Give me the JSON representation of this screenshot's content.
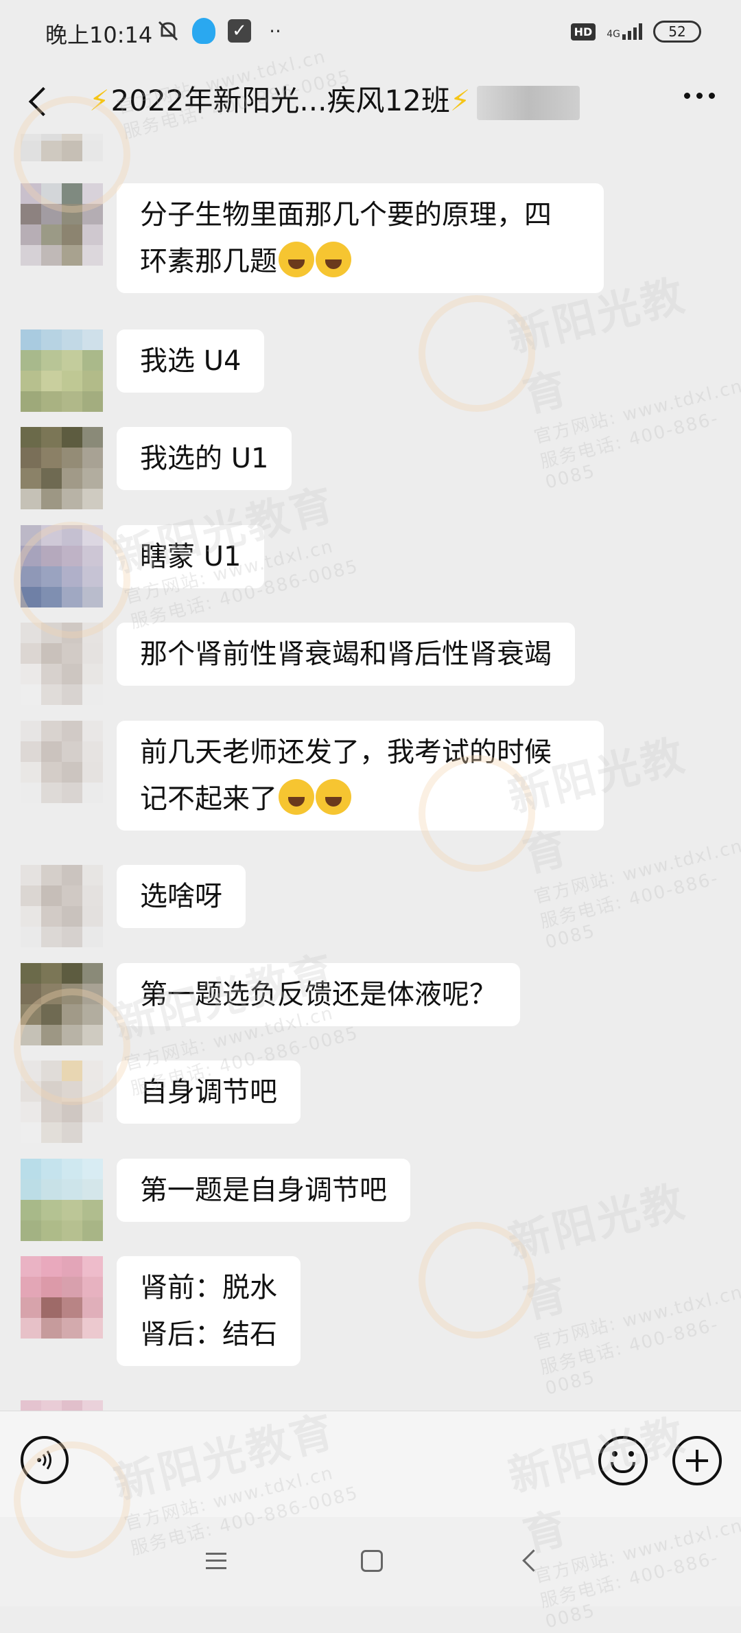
{
  "status_bar": {
    "time": "晚上10:14",
    "network": "4G",
    "hd": "HD",
    "battery": "52"
  },
  "header": {
    "title": "2022年新阳光...疾风12班"
  },
  "messages": [
    {
      "text": "分子生物里面那几个要的原理，四\n环素那几题",
      "emoji_count": 2
    },
    {
      "text": "我选 U4"
    },
    {
      "text": "我选的 U1"
    },
    {
      "text": "瞎蒙 U1"
    },
    {
      "text": "那个肾前性肾衰竭和肾后性肾衰竭"
    },
    {
      "text": "前几天老师还发了，我考试的时候\n记不起来了",
      "emoji_count": 2
    },
    {
      "text": "选啥呀"
    },
    {
      "text": "第一题选负反馈还是体液呢？"
    },
    {
      "text": "自身调节吧"
    },
    {
      "text": "第一题是自身调节吧"
    },
    {
      "text": "肾前：脱水\n肾后：结石"
    }
  ],
  "watermark": {
    "logo": "新阳光教育",
    "site": "官方网站: www.tdxl.cn",
    "phone": "服务电话: 400-886-0085"
  },
  "icons": {
    "back": "back-arrow-icon",
    "more": "more-dots-icon",
    "voice": "voice-icon",
    "emoji": "emoji-icon",
    "plus": "plus-icon"
  }
}
